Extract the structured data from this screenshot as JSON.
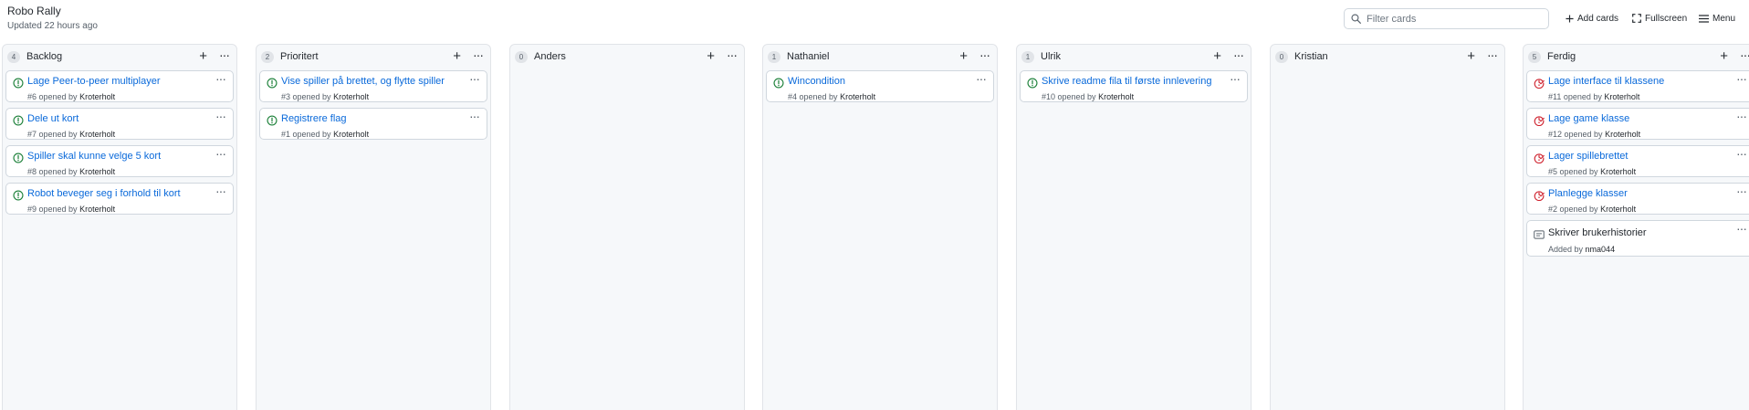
{
  "project": {
    "title": "Robo Rally",
    "updated": "Updated 22 hours ago"
  },
  "toolbar": {
    "filter_placeholder": "Filter cards",
    "add_cards": "Add cards",
    "fullscreen": "Fullscreen",
    "menu": "Menu"
  },
  "colors": {
    "open_issue": "#1a7f37",
    "closed_issue": "#cf222e",
    "link": "#0969da"
  },
  "columns": [
    {
      "count": "4",
      "name": "Backlog",
      "cards": [
        {
          "kind": "issue-open",
          "title": "Lage Peer-to-peer multiplayer",
          "meta": "#6 opened by",
          "author": "Kroterholt"
        },
        {
          "kind": "issue-open",
          "title": "Dele ut kort",
          "meta": "#7 opened by",
          "author": "Kroterholt"
        },
        {
          "kind": "issue-open",
          "title": "Spiller skal kunne velge 5 kort",
          "meta": "#8 opened by",
          "author": "Kroterholt"
        },
        {
          "kind": "issue-open",
          "title": "Robot beveger seg i forhold til kort",
          "meta": "#9 opened by",
          "author": "Kroterholt"
        }
      ]
    },
    {
      "count": "2",
      "name": "Prioritert",
      "cards": [
        {
          "kind": "issue-open",
          "title": "Vise spiller på brettet, og flytte spiller",
          "meta": "#3 opened by",
          "author": "Kroterholt"
        },
        {
          "kind": "issue-open",
          "title": "Registrere flag",
          "meta": "#1 opened by",
          "author": "Kroterholt"
        }
      ]
    },
    {
      "count": "0",
      "name": "Anders",
      "cards": []
    },
    {
      "count": "1",
      "name": "Nathaniel",
      "cards": [
        {
          "kind": "issue-open",
          "title": "Wincondition",
          "meta": "#4 opened by",
          "author": "Kroterholt"
        }
      ]
    },
    {
      "count": "1",
      "name": "Ulrik",
      "cards": [
        {
          "kind": "issue-open",
          "title": "Skrive readme fila til første innlevering",
          "meta": "#10 opened by",
          "author": "Kroterholt"
        }
      ]
    },
    {
      "count": "0",
      "name": "Kristian",
      "cards": []
    },
    {
      "count": "5",
      "name": "Ferdig",
      "cards": [
        {
          "kind": "issue-closed",
          "title": "Lage interface til klassene",
          "meta": "#11 opened by",
          "author": "Kroterholt"
        },
        {
          "kind": "issue-closed",
          "title": "Lage game klasse",
          "meta": "#12 opened by",
          "author": "Kroterholt"
        },
        {
          "kind": "issue-closed",
          "title": "Lager spillebrettet",
          "meta": "#5 opened by",
          "author": "Kroterholt"
        },
        {
          "kind": "issue-closed",
          "title": "Planlegge klasser",
          "meta": "#2 opened by",
          "author": "Kroterholt"
        },
        {
          "kind": "note",
          "title": "Skriver brukerhistorier",
          "meta": "Added by",
          "author": "nma044"
        }
      ]
    }
  ]
}
